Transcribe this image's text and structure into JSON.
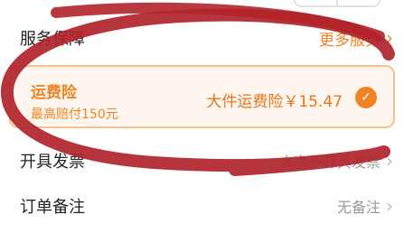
{
  "service": {
    "label": "服务保障",
    "link": "更多服务"
  },
  "insurance": {
    "title": "运费险",
    "subtitle": "最高赔付150元",
    "price": "大件运费险￥15.47",
    "selected": true
  },
  "invoice": {
    "label": "开具发票",
    "value": "本次不开具发票"
  },
  "note": {
    "label": "订单备注",
    "value": "无备注"
  },
  "colors": {
    "accent": "#f08324",
    "scribble": "#b0232a",
    "muted": "#999999"
  },
  "icons": {
    "chevron": "chevron-right-icon",
    "check": "check-icon"
  }
}
